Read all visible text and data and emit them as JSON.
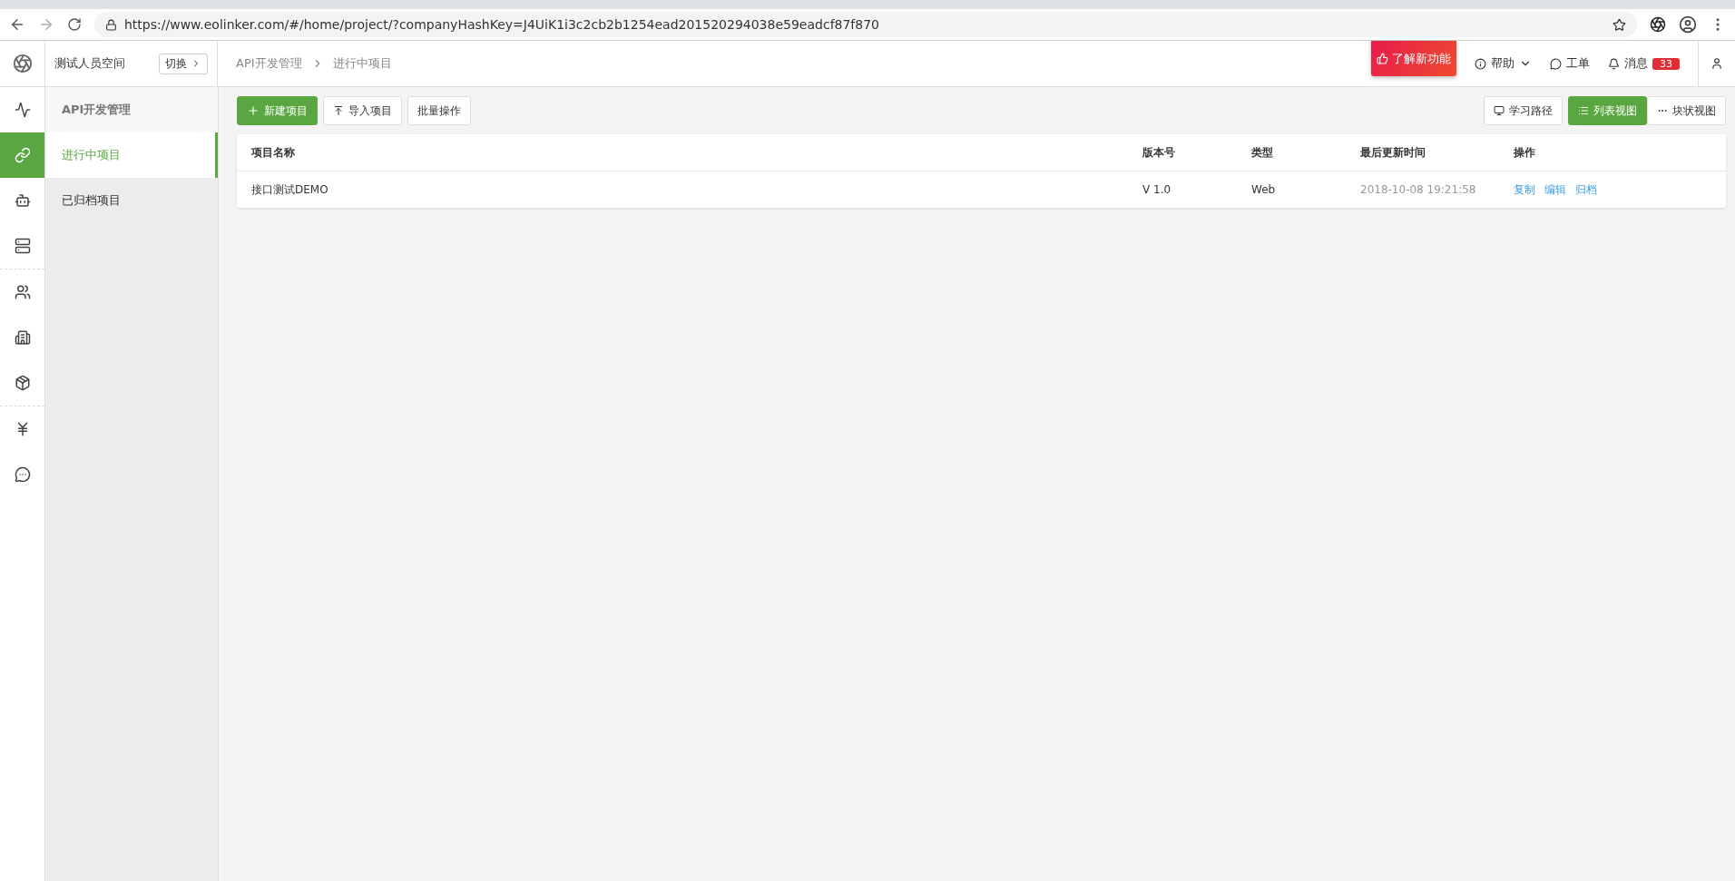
{
  "browser": {
    "url": "https://www.eolinker.com/#/home/project/?companyHashKey=J4UiK1i3c2cb2b1254ead201520294038e59eadcf87f870"
  },
  "workspace": {
    "name": "测试人员空间",
    "switch_label": "切换"
  },
  "rail": {
    "groups": [
      [
        {
          "selected": false
        },
        {
          "selected": true
        },
        {
          "selected": false
        },
        {
          "selected": false
        }
      ],
      [
        {
          "selected": false
        },
        {
          "selected": false
        },
        {
          "selected": false
        }
      ],
      [
        {
          "selected": false
        },
        {
          "selected": false
        }
      ]
    ]
  },
  "breadcrumb": [
    "API开发管理",
    "进行中项目"
  ],
  "header_actions": {
    "feature_button": "了解新功能",
    "help": "帮助",
    "tickets": "工单",
    "messages": "消息",
    "message_count": "33"
  },
  "sidebar": {
    "title": "API开发管理",
    "items": [
      {
        "label": "进行中项目",
        "selected": true
      },
      {
        "label": "已归档项目",
        "selected": false
      }
    ]
  },
  "toolbar": {
    "buttons": [
      {
        "label": "新建项目",
        "kind": "primary"
      },
      {
        "label": "导入项目",
        "kind": "import"
      },
      {
        "label": "批量操作",
        "kind": "plain"
      }
    ],
    "guide": "学习路径",
    "views": [
      {
        "label": "列表视图",
        "selected": true
      },
      {
        "label": "块状视图",
        "selected": false
      }
    ]
  },
  "table": {
    "columns": [
      "项目名称",
      "版本号",
      "类型",
      "最后更新时间",
      "操作"
    ],
    "rows": [
      {
        "name": "接口测试DEMO",
        "version": "V 1.0",
        "type": "Web",
        "updated": "2018-10-08 19:21:58",
        "actions": [
          "复制",
          "编辑",
          "归档"
        ]
      }
    ]
  }
}
